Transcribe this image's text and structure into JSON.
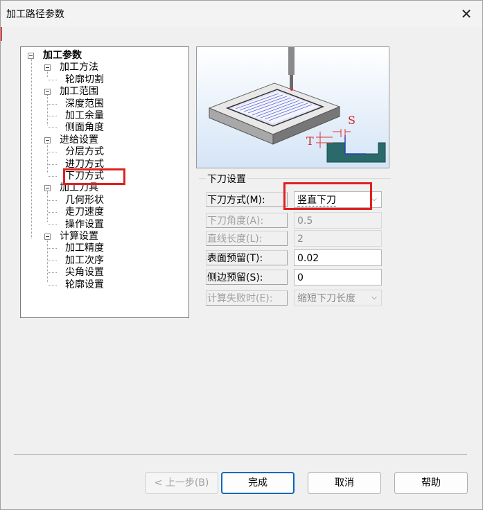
{
  "window": {
    "title": "加工路径参数",
    "close_glyph": "✕"
  },
  "tree": {
    "nodes": [
      {
        "label": "加工参数",
        "level": 0,
        "expandable": true,
        "bold": true
      },
      {
        "label": "加工方法",
        "level": 1,
        "expandable": true
      },
      {
        "label": "轮廓切割",
        "level": 2
      },
      {
        "label": "加工范围",
        "level": 1,
        "expandable": true
      },
      {
        "label": "深度范围",
        "level": 2
      },
      {
        "label": "加工余量",
        "level": 2
      },
      {
        "label": "侧面角度",
        "level": 2
      },
      {
        "label": "进给设置",
        "level": 1,
        "expandable": true
      },
      {
        "label": "分层方式",
        "level": 2
      },
      {
        "label": "进刀方式",
        "level": 2
      },
      {
        "label": "下刀方式",
        "level": 2,
        "selected": true
      },
      {
        "label": "加工刀具",
        "level": 1,
        "expandable": true
      },
      {
        "label": "几何形状",
        "level": 2
      },
      {
        "label": "走刀速度",
        "level": 2
      },
      {
        "label": "操作设置",
        "level": 2
      },
      {
        "label": "计算设置",
        "level": 1,
        "expandable": true
      },
      {
        "label": "加工精度",
        "level": 2
      },
      {
        "label": "加工次序",
        "level": 2
      },
      {
        "label": "尖角设置",
        "level": 2
      },
      {
        "label": "轮廓设置",
        "level": 2
      }
    ]
  },
  "preview": {
    "label_s": "S",
    "label_t": "T"
  },
  "group": {
    "title": "下刀设置",
    "rows": [
      {
        "label": "下刀方式(M):",
        "value": "竖直下刀",
        "type": "combo",
        "enabled": true
      },
      {
        "label": "下刀角度(A):",
        "value": "0.5",
        "type": "text",
        "enabled": false
      },
      {
        "label": "直线长度(L):",
        "value": "2",
        "type": "text",
        "enabled": false
      },
      {
        "label": "表面预留(T):",
        "value": "0.02",
        "type": "text",
        "enabled": true
      },
      {
        "label": "侧边预留(S):",
        "value": "0",
        "type": "text",
        "enabled": true
      },
      {
        "label": "计算失败时(E):",
        "value": "缩短下刀长度",
        "type": "combo",
        "enabled": false
      }
    ]
  },
  "buttons": {
    "back": "< 上一步(B)",
    "finish": "完成",
    "cancel": "取消",
    "help": "帮助"
  },
  "colors": {
    "highlight": "#e02020",
    "accent": "#0067c0"
  }
}
